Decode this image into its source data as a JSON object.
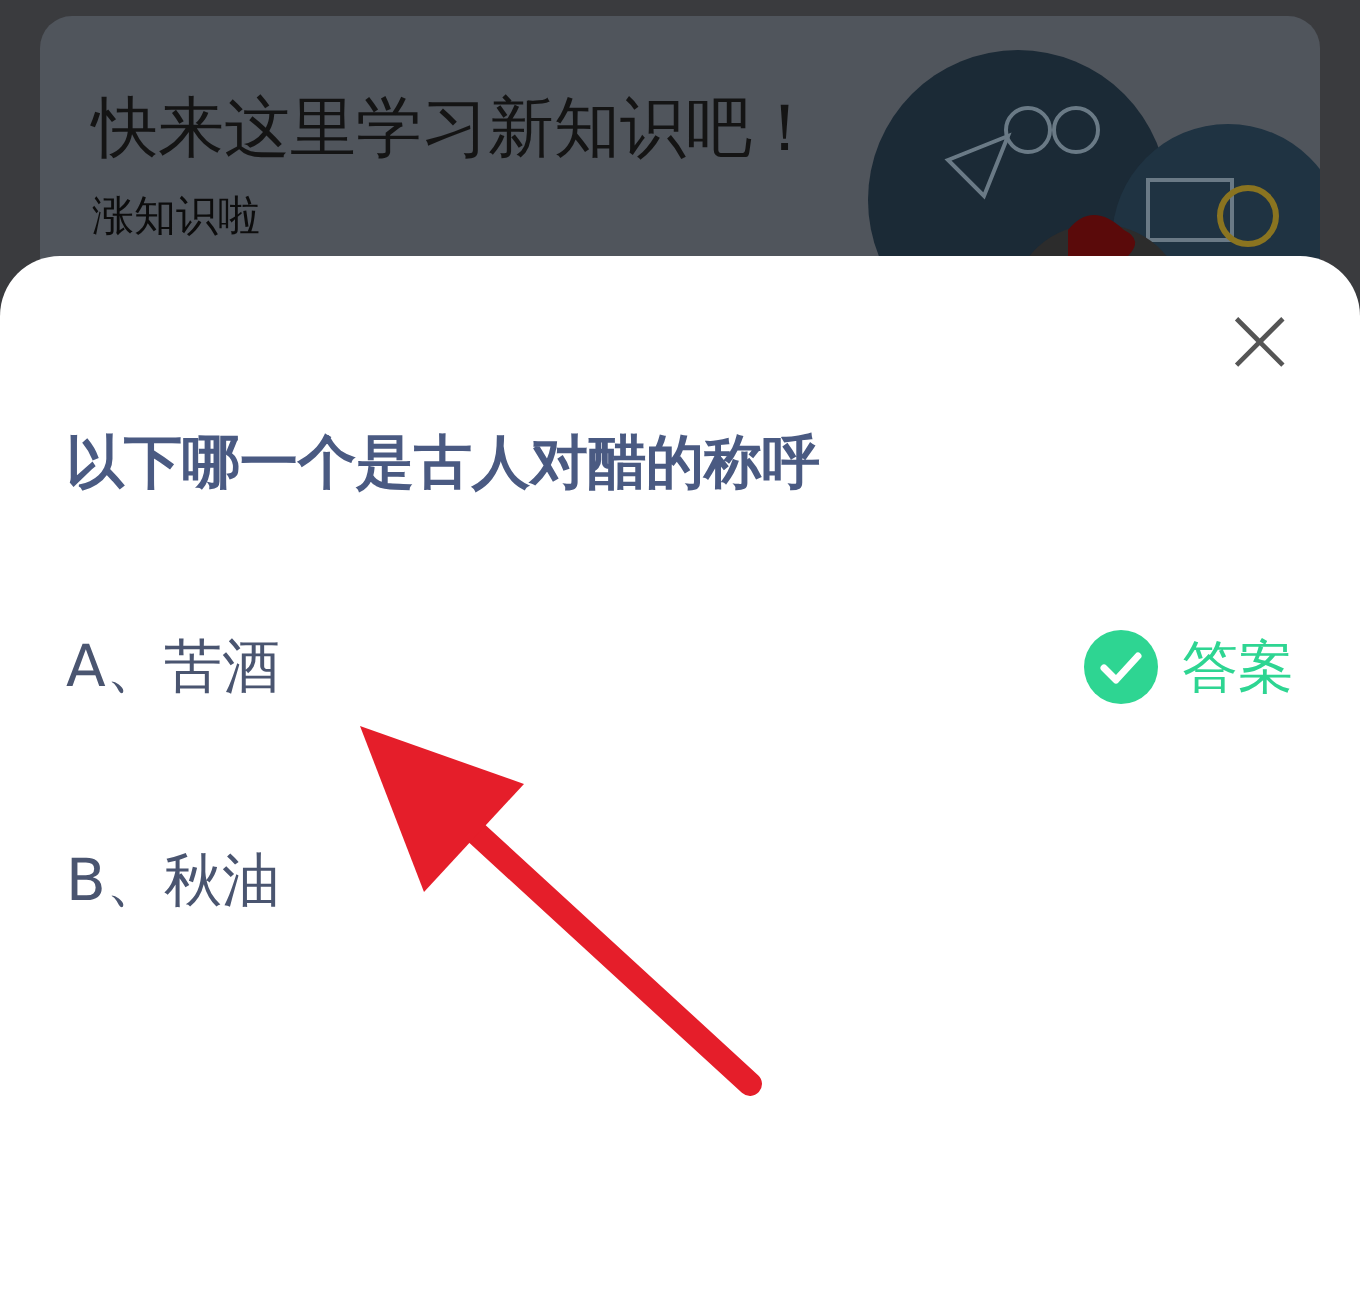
{
  "banner": {
    "title": "快来这里学习新知识吧！",
    "subtitle": "涨知识啦"
  },
  "quiz": {
    "close": "×",
    "question": "以下哪一个是古人对醋的称呼",
    "options": [
      {
        "label": "A、苦酒",
        "correct": true
      },
      {
        "label": "B、秋油",
        "correct": false
      }
    ],
    "answer_label": "答案"
  }
}
